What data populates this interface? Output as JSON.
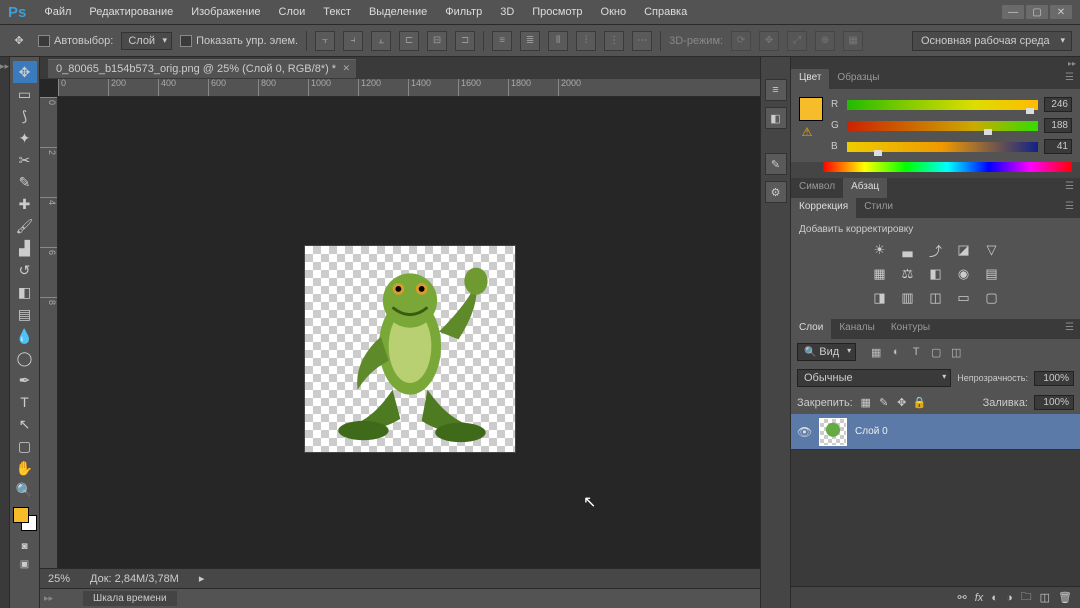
{
  "app_logo": "Ps",
  "menu": [
    "Файл",
    "Редактирование",
    "Изображение",
    "Слои",
    "Текст",
    "Выделение",
    "Фильтр",
    "3D",
    "Просмотр",
    "Окно",
    "Справка"
  ],
  "options": {
    "auto_select_label": "Автовыбор:",
    "auto_select_value": "Слой",
    "show_controls_label": "Показать упр. элем.",
    "mode_3d_label": "3D-режим:"
  },
  "workspace_label": "Основная рабочая среда",
  "doc_tab": "0_80065_b154b573_orig.png @ 25% (Слой 0, RGB/8*) *",
  "ruler_h": [
    "0",
    "200",
    "400",
    "600",
    "800",
    "1000",
    "1200",
    "1400",
    "1600",
    "1800",
    "2000"
  ],
  "ruler_v": [
    "0",
    "2",
    "4",
    "6",
    "8"
  ],
  "zoom_label": "25%",
  "doc_info": "Док: 2,84M/3,78M",
  "timeline_label": "Шкала времени",
  "panels": {
    "color_tab": "Цвет",
    "swatches_tab": "Образцы",
    "r_label": "R",
    "r_val": "246",
    "g_label": "G",
    "g_val": "188",
    "b_label": "B",
    "b_val": "41",
    "symbol_tab": "Символ",
    "paragraph_tab": "Абзац",
    "corrections_tab": "Коррекция",
    "styles_tab": "Стили",
    "add_correction": "Добавить корректировку",
    "layers_tab": "Слои",
    "channels_tab": "Каналы",
    "paths_tab": "Контуры",
    "filter_kind": "Вид",
    "blend_mode": "Обычные",
    "opacity_label": "Непрозрачность:",
    "opacity_val": "100%",
    "lock_label": "Закрепить:",
    "fill_label": "Заливка:",
    "fill_val": "100%",
    "layer0_name": "Слой 0"
  }
}
